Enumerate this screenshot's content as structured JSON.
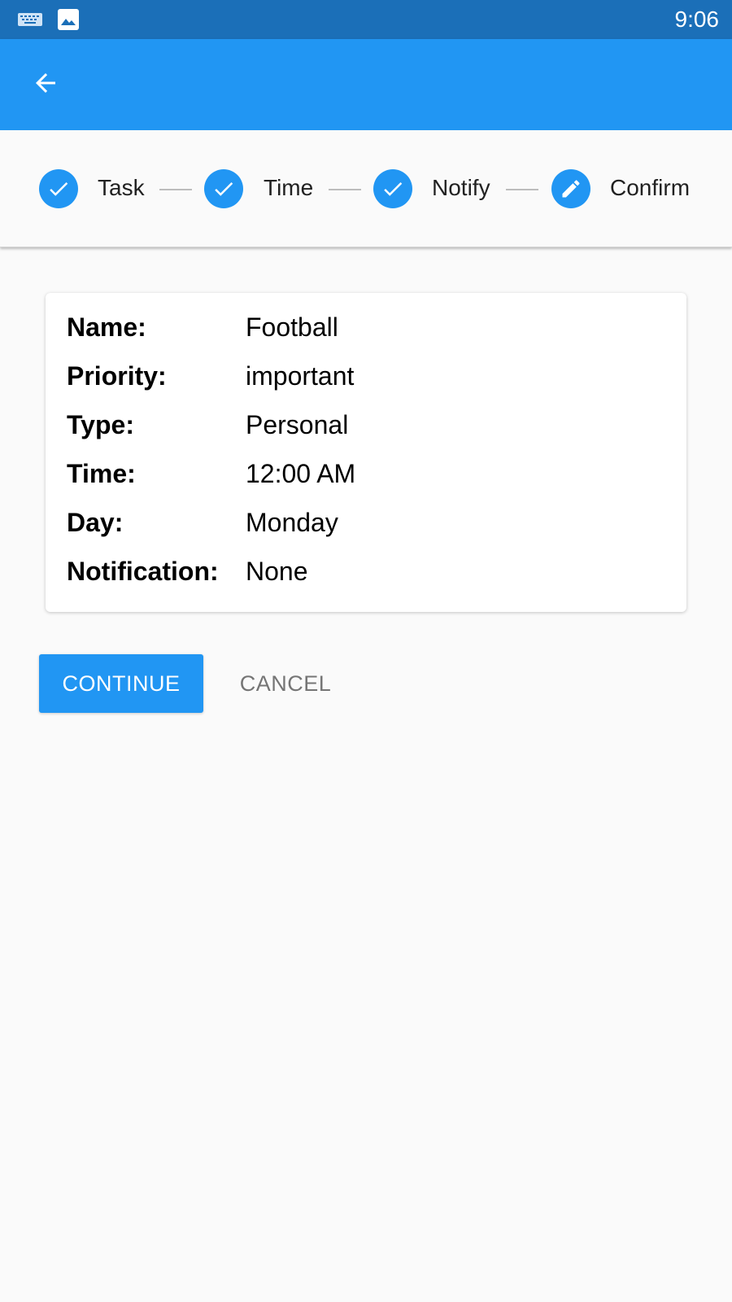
{
  "status_bar": {
    "time": "9:06",
    "icons": [
      "keyboard-icon",
      "image-icon"
    ]
  },
  "app_bar": {
    "back_icon": "arrow-back-icon"
  },
  "stepper": {
    "steps": [
      {
        "label": "Task",
        "state": "completed",
        "icon": "check-icon"
      },
      {
        "label": "Time",
        "state": "completed",
        "icon": "check-icon"
      },
      {
        "label": "Notify",
        "state": "completed",
        "icon": "check-icon"
      },
      {
        "label": "Confirm",
        "state": "editing",
        "icon": "pencil-icon"
      }
    ]
  },
  "summary": {
    "rows": [
      {
        "key": "Name:",
        "value": "Football"
      },
      {
        "key": "Priority:",
        "value": "important"
      },
      {
        "key": "Type:",
        "value": "Personal"
      },
      {
        "key": "Time:",
        "value": "12:00 AM"
      },
      {
        "key": "Day:",
        "value": "Monday"
      },
      {
        "key": "Notification:",
        "value": "None"
      }
    ]
  },
  "actions": {
    "continue_label": "CONTINUE",
    "cancel_label": "CANCEL"
  },
  "colors": {
    "primary": "#2196f3",
    "status_bar": "#1b6fb8",
    "background": "#fafafa"
  }
}
